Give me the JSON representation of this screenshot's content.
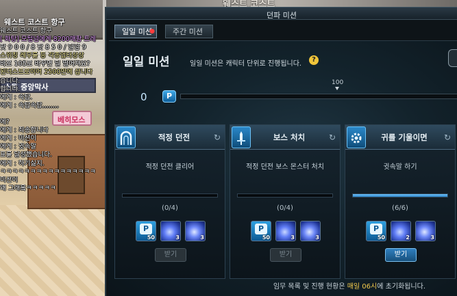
{
  "background": {
    "building_sign": "웨스트 코스트 항구",
    "top_strip_text": "웨스트 코스트",
    "shop_sign": "스트 중앙막사",
    "pink_sign": "베히모스",
    "chat_lines": [
      {
        "text": "웨스트 코스트 항구",
        "style": "white"
      },
      {
        "text": "[ 화탕] 모털넘에게 8200매팜 트레",
        "style": "purple"
      },
      {
        "text": "팟 9 0 0 / 8 팟 8 5 0 / 달암 9",
        "style": "white"
      },
      {
        "text": "스위칭 레무를 등 각종업터상상",
        "style": "yellow"
      },
      {
        "text": "바로 105로 바꾸면 딜 떨어져요?",
        "style": "white"
      },
      {
        "text": "된더스트로이어 2500만에 삽니다",
        "style": "yellow"
      },
      {
        "text": "습니다.",
        "style": "white"
      },
      {
        "text": "합니다.",
        "style": "white"
      },
      {
        "text": "에게 : 속탑.",
        "style": "white"
      },
      {
        "text": "에게 : 속탑속탑,,,,,,,,",
        "style": "white"
      },
      {
        "text": "",
        "style": "white"
      },
      {
        "text": "에?",
        "style": "white"
      },
      {
        "text": "에게 : 죄송합니다",
        "style": "white"
      },
      {
        "text": "에게 : 미션이",
        "style": "white"
      },
      {
        "text": "에게 : 귓속말",
        "style": "white"
      },
      {
        "text": "표를 달성했습니다.",
        "style": "white"
      },
      {
        "text": "에게 : 하기싫지.",
        "style": "white"
      },
      {
        "text": "ㅋㅋㅋㅋㅋㅋㅋㅋㅋㅋㅋㅋㅋㅋㅋㅋ",
        "style": "white"
      },
      {
        "text": "미션이",
        "style": "white"
      },
      {
        "text": "왜 그래욬ㅋㅋㅋㅋㅋ",
        "style": "white"
      }
    ]
  },
  "window": {
    "title": "던파 미션",
    "tabs": [
      {
        "label": "일일 미션",
        "active": true,
        "has_alert": true
      },
      {
        "label": "주간 미션",
        "active": false,
        "has_alert": false
      }
    ]
  },
  "panel": {
    "title": "일일 미션",
    "description": "일일 미션은 캐릭터 단위로 진행됩니다.",
    "help_icon": "?",
    "progress": {
      "current": "0",
      "max": "100",
      "badge": "P",
      "fraction": 0
    },
    "missions": [
      {
        "name": "적정 던전",
        "emblem": "gate-icon",
        "description": "적정 던전 클리어",
        "count": "(0/4)",
        "fraction": 0,
        "rewards": [
          {
            "icon": "p-point-icon",
            "label": "P",
            "qty": "50"
          },
          {
            "icon": "blue-orb-icon",
            "qty": "3"
          },
          {
            "icon": "blue-orb-icon",
            "qty": "3"
          }
        ],
        "claim_label": "받기",
        "claim_enabled": false
      },
      {
        "name": "보스 처치",
        "emblem": "sword-icon",
        "description": "적정 던전 보스 몬스터 처치",
        "count": "(0/4)",
        "fraction": 0,
        "rewards": [
          {
            "icon": "p-point-icon",
            "label": "P",
            "qty": "50"
          },
          {
            "icon": "blue-orb-icon",
            "qty": "3"
          },
          {
            "icon": "blue-orb-icon",
            "qty": "3"
          }
        ],
        "claim_label": "받기",
        "claim_enabled": false
      },
      {
        "name": "귀를 기울이면",
        "emblem": "gear-icon",
        "description": "귓속말 하기",
        "count": "(6/6)",
        "fraction": 1,
        "rewards": [
          {
            "icon": "p-point-icon",
            "label": "P",
            "qty": "50"
          },
          {
            "icon": "blue-orb-icon",
            "qty": "2"
          },
          {
            "icon": "blue-orb-icon",
            "qty": "3"
          }
        ],
        "claim_label": "받기",
        "claim_enabled": true
      }
    ],
    "footer_prefix": "임무 목록 및 진행 현황은 ",
    "footer_highlight": "매일 06시",
    "footer_suffix": "에 초기화됩니다."
  },
  "colors": {
    "accent": "#2f7fbf",
    "progress_fill": "#6fc5ff",
    "alert": "#ff3d3d",
    "footer_highlight": "#f2c94c"
  }
}
